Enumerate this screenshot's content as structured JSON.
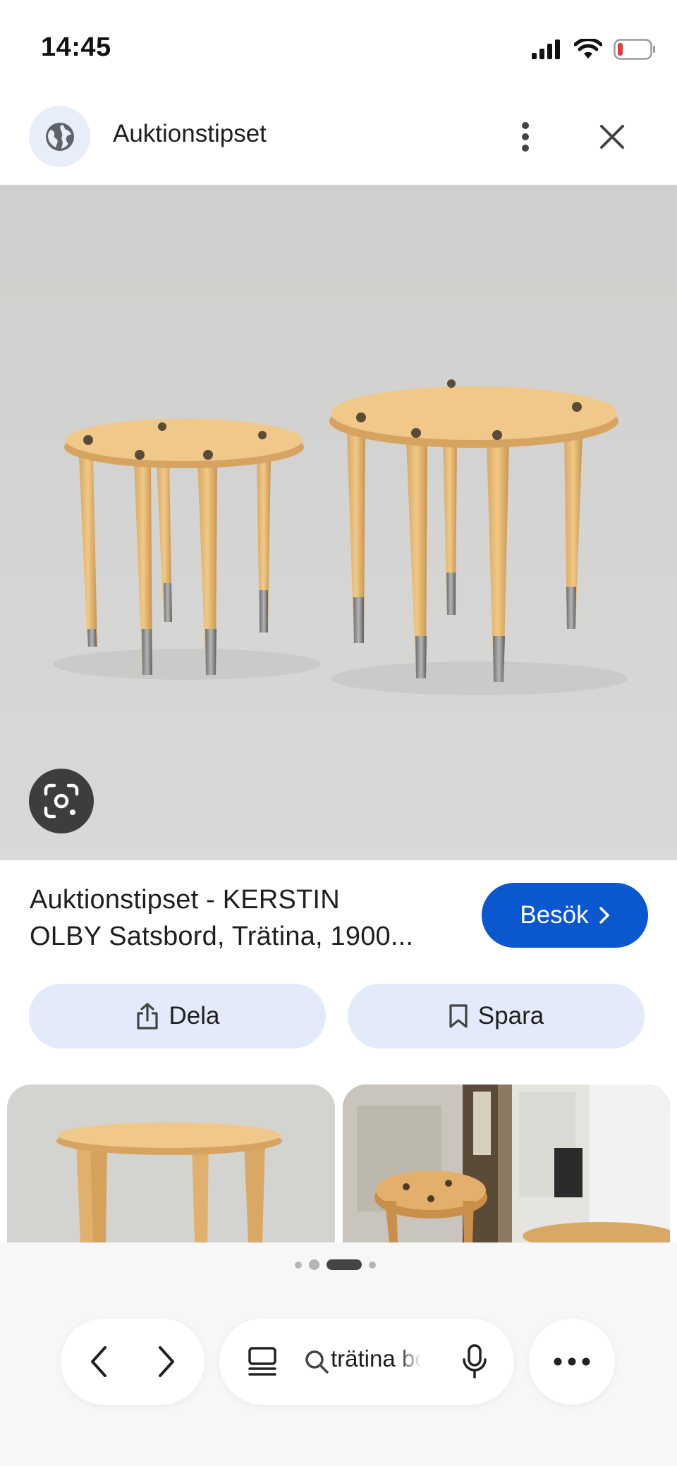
{
  "status_bar": {
    "time": "14:45",
    "icons": [
      "signal-icon",
      "wifi-icon",
      "battery-low-icon"
    ]
  },
  "header": {
    "site_name": "Auktionstipset",
    "icons": [
      "globe-icon",
      "more-vertical-icon",
      "close-icon"
    ]
  },
  "result": {
    "title_line1": "Auktionstipset - KERSTIN",
    "title_line2": "OLBY Satsbord, Trätina, 1900...",
    "visit_label": "Besök",
    "share_label": "Dela",
    "save_label": "Spara"
  },
  "bottom_bar": {
    "search_query": "trätina bord",
    "icons": [
      "back-icon",
      "forward-icon",
      "tabs-icon",
      "search-icon",
      "mic-icon",
      "more-horizontal-icon"
    ]
  },
  "colors": {
    "accent": "#0b57d0",
    "chip_background": "#e3ebfb",
    "battery_low": "#e33b3b"
  }
}
